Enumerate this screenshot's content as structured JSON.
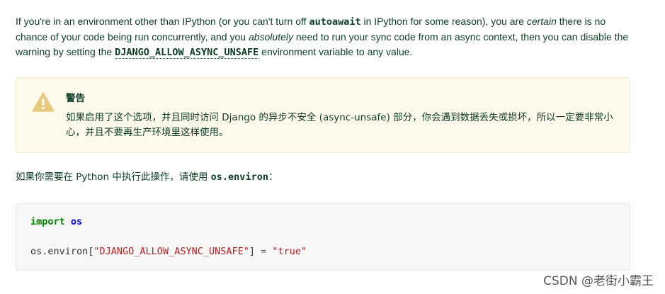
{
  "intro": {
    "t1": "If you're in an environment other than IPython (or you can't turn off ",
    "code1": "autoawait",
    "t2": " in IPython for some reason), you are ",
    "em1": "certain",
    "t3": " there is no chance of your code being run concurrently, and you ",
    "em2": "absolutely",
    "t4": " need to run your sync code from an async context, then you can disable the warning by setting the ",
    "code2": "DJANGO_ALLOW_ASYNC_UNSAFE",
    "t5": " environment variable to any value."
  },
  "warning": {
    "icon": "warning-triangle-icon",
    "title": "警告",
    "text": "如果启用了这个选项，并且同时访问 Django 的异步不安全 (async-unsafe) 部分，你会遇到数据丢失或损坏，所以一定要非常小心，并且不要再生产环境里这样使用。",
    "colors": {
      "background": "#fdfaec",
      "icon": "#e8c87c"
    }
  },
  "python_line": {
    "text": "如果你需要在 Python 中执行此操作，请使用 ",
    "code": "os.environ",
    "suffix": "："
  },
  "code": {
    "line1_kw": "import",
    "line1_mod": "os",
    "line2_obj": "os.environ[",
    "line2_str": "\"DJANGO_ALLOW_ASYNC_UNSAFE\"",
    "line2_close": "]",
    "line2_eq": " = ",
    "line2_val": "\"true\""
  },
  "watermark": "CSDN @老街小霸王"
}
